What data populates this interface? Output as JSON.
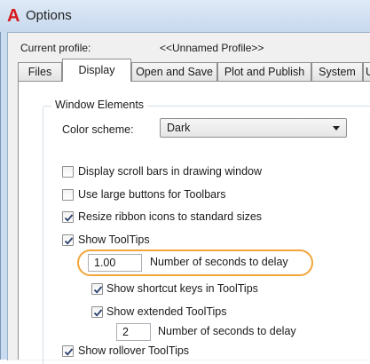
{
  "window": {
    "title": "Options",
    "app_letter": "A"
  },
  "profile": {
    "label": "Current profile:",
    "value": "<<Unnamed Profile>>"
  },
  "tabs": [
    {
      "label": "Files"
    },
    {
      "label": "Display",
      "active": true
    },
    {
      "label": "Open and Save"
    },
    {
      "label": "Plot and Publish"
    },
    {
      "label": "System"
    },
    {
      "label": "U"
    }
  ],
  "window_elements": {
    "group_label": "Window Elements",
    "color_scheme": {
      "label": "Color scheme:",
      "value": "Dark"
    },
    "options": {
      "scroll_bars": {
        "label": "Display scroll bars in drawing window",
        "checked": false
      },
      "large_buttons": {
        "label": "Use large buttons for Toolbars",
        "checked": false
      },
      "resize_ribbon": {
        "label": "Resize ribbon icons to standard sizes",
        "checked": true
      },
      "show_tooltips": {
        "label": "Show ToolTips",
        "checked": true
      },
      "tooltip_delay": {
        "value": "1.00",
        "label": "Number of seconds to delay"
      },
      "show_shortcut_keys": {
        "label": "Show shortcut keys in ToolTips",
        "checked": true
      },
      "show_extended": {
        "label": "Show extended ToolTips",
        "checked": true
      },
      "extended_delay": {
        "value": "2",
        "label": "Number of seconds to delay"
      },
      "show_rollover": {
        "label": "Show rollover ToolTips",
        "checked": true
      }
    }
  },
  "colors": {
    "highlight": "#f3a53a",
    "title_icon": "#d7191c"
  }
}
